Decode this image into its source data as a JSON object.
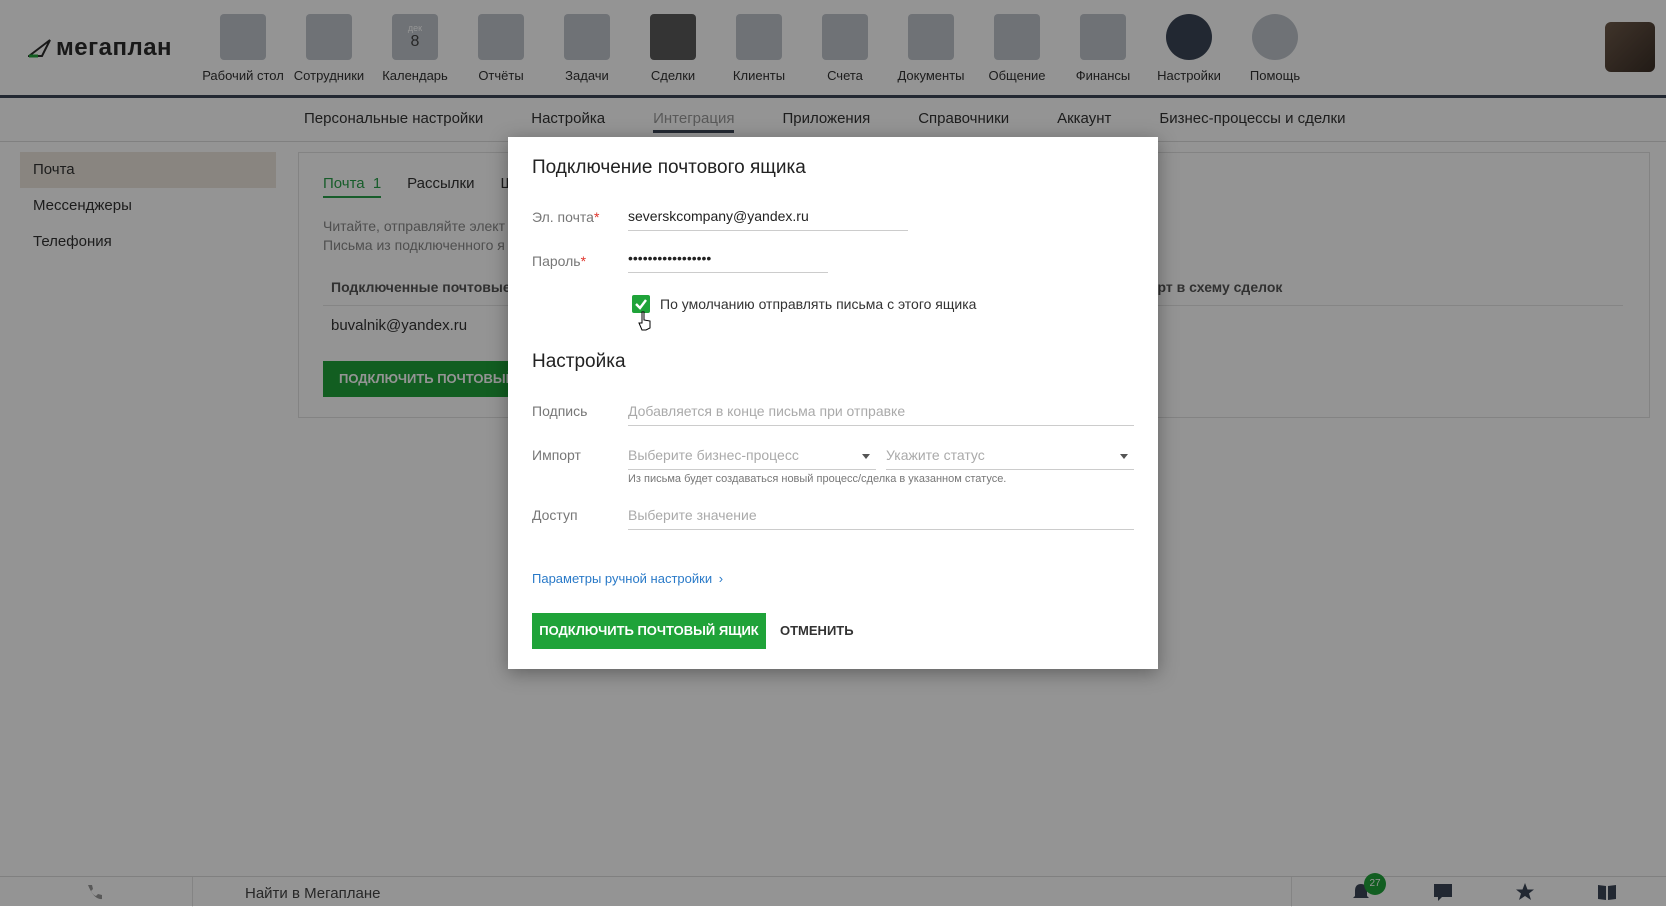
{
  "app": {
    "logo_text": "мегаплан",
    "nav": [
      {
        "label": "Рабочий стол",
        "icon": "desktop-icon"
      },
      {
        "label": "Сотрудники",
        "icon": "employees-icon"
      },
      {
        "label": "Календарь",
        "icon": "calendar-icon",
        "badge_day": "8",
        "badge_month": "дек"
      },
      {
        "label": "Отчёты",
        "icon": "reports-icon"
      },
      {
        "label": "Задачи",
        "icon": "tasks-icon"
      },
      {
        "label": "Сделки",
        "icon": "deals-icon"
      },
      {
        "label": "Клиенты",
        "icon": "clients-icon"
      },
      {
        "label": "Счета",
        "icon": "invoices-icon"
      },
      {
        "label": "Документы",
        "icon": "documents-icon"
      },
      {
        "label": "Общение",
        "icon": "chat-icon"
      },
      {
        "label": "Финансы",
        "icon": "finance-icon"
      },
      {
        "label": "Настройки",
        "icon": "gear-icon",
        "active": true
      },
      {
        "label": "Помощь",
        "icon": "help-icon"
      }
    ]
  },
  "subnav": {
    "items": [
      "Персональные настройки",
      "Настройка",
      "Интеграция",
      "Приложения",
      "Справочники",
      "Аккаунт",
      "Бизнес-процессы и сделки"
    ],
    "active": "Интеграция"
  },
  "sidebar": {
    "items": [
      "Почта",
      "Мессенджеры",
      "Телефония"
    ],
    "active": "Почта"
  },
  "card": {
    "tabs": [
      {
        "label": "Почта",
        "count": "1"
      },
      {
        "label": "Рассылки"
      },
      {
        "label": "Ша"
      }
    ],
    "desc_line1": "Читайте, отправляйте элект",
    "desc_line2": "Письма из подключенного я",
    "col1": "Подключенные почтовые я",
    "col2": "орт в схему сделок",
    "row_email": "buvalnik@yandex.ru",
    "button": "ПОДКЛЮЧИТЬ ПОЧТОВЫЙ Я"
  },
  "modal": {
    "title": "Подключение почтового ящика",
    "email_label": "Эл. почта",
    "email_value": "severskcompany@yandex.ru",
    "password_label": "Пароль",
    "password_value": "•••••••••••••••••",
    "required_mark": "*",
    "default_checkbox_label": "По умолчанию отправлять письма с этого ящика",
    "settings_title": "Настройка",
    "signature_label": "Подпись",
    "signature_placeholder": "Добавляется в конце письма при отправке",
    "import_label": "Импорт",
    "import_process_placeholder": "Выберите бизнес-процесс",
    "import_status_placeholder": "Укажите статус",
    "import_hint": "Из письма будет создаваться новый процесс/сделка в указанном статусе.",
    "access_label": "Доступ",
    "access_placeholder": "Выберите значение",
    "manual_link": "Параметры ручной настройки",
    "submit": "ПОДКЛЮЧИТЬ ПОЧТОВЫЙ ЯЩИК",
    "cancel": "ОТМЕНИТЬ"
  },
  "footer": {
    "search_text": "Найти в Мегаплане",
    "notifications_count": "27"
  },
  "colors": {
    "accent": "#1fa339",
    "nav_dark": "#3b4556",
    "link": "#2a7ac8"
  }
}
